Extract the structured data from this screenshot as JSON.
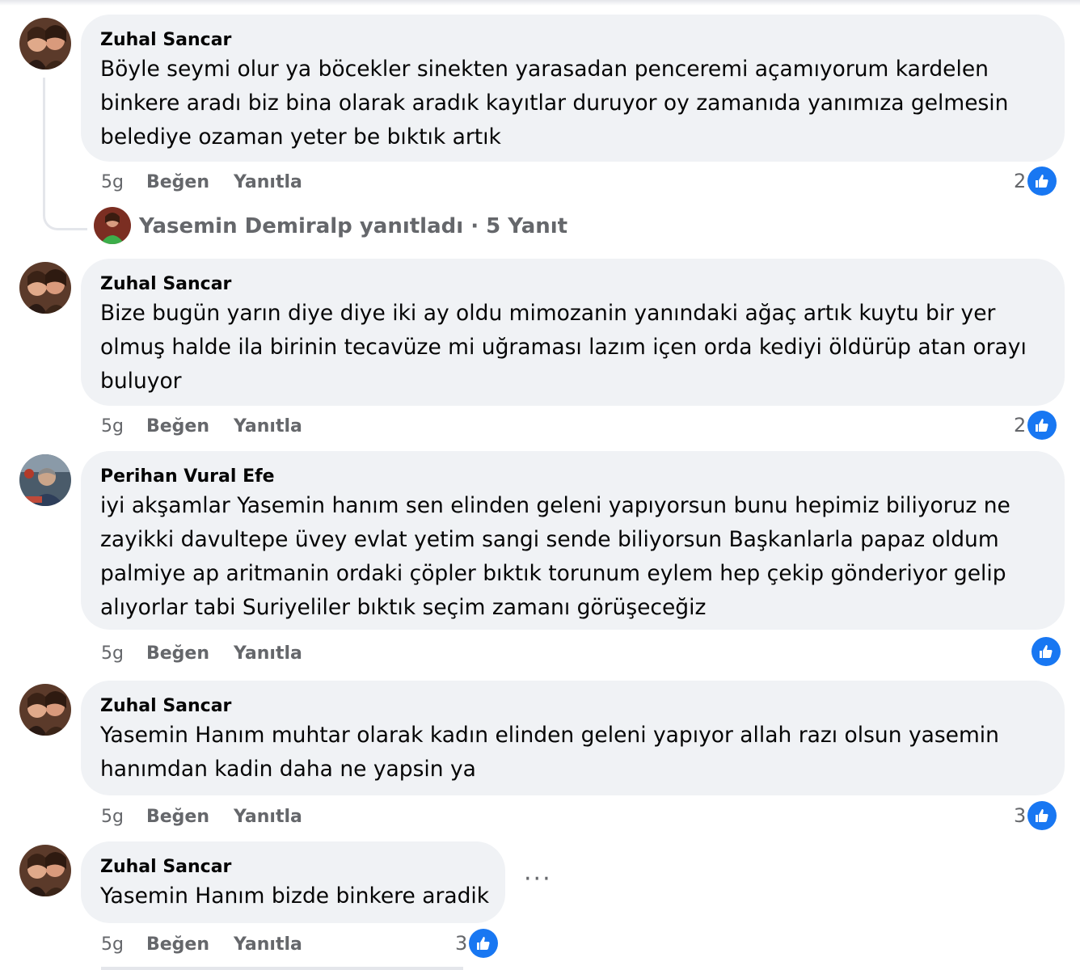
{
  "comments": [
    {
      "author": "Zuhal Sancar",
      "lines": [
        "Böyle seymi olur ya böcekler sinekten yarasadan penceremi açamıyorum kardelen",
        "binkere aradı biz bina olarak aradık kayıtlar duruyor oy zamanıda yanımıza gelmesin",
        "belediye ozaman yeter be bıktık artık"
      ],
      "time": "5g",
      "like": "Beğen",
      "reply": "Yanıtla",
      "reactions": "2",
      "replies_summary": "Yasemin Demiralp yanıtladı · 5 Yanıt"
    },
    {
      "author": "Zuhal Sancar",
      "lines": [
        "Bize bugün yarın diye diye iki ay oldu mimozanin yanındaki ağaç artık kuytu bir yer",
        "olmuş halde ila birinin tecavüze mi uğraması lazım içen orda kediyi öldürüp atan orayı",
        "buluyor"
      ],
      "time": "5g",
      "like": "Beğen",
      "reply": "Yanıtla",
      "reactions": "2"
    },
    {
      "author": "Perihan Vural Efe",
      "lines": [
        "iyi akşamlar Yasemin hanım sen elinden geleni yapıyorsun bunu hepimiz biliyoruz ne",
        "zayikki davultepe üvey evlat yetim sangi sende biliyorsun Başkanlarla papaz oldum",
        "palmiye ap aritmanin ordaki çöpler bıktık torunum eylem hep çekip gönderiyor gelip",
        "alıyorlar tabi Suriyeliler bıktık seçim zamanı görüşeceğiz"
      ],
      "time": "5g",
      "like": "Beğen",
      "reply": "Yanıtla",
      "reactions": ""
    },
    {
      "author": "Zuhal Sancar",
      "lines": [
        "Yasemin Hanım muhtar olarak kadın elinden geleni yapıyor allah razı olsun yasemin",
        "hanımdan kadin daha ne yapsin ya"
      ],
      "time": "5g",
      "like": "Beğen",
      "reply": "Yanıtla",
      "reactions": "3"
    },
    {
      "author": "Zuhal Sancar",
      "lines": [
        "Yasemin Hanım bizde binkere aradik"
      ],
      "time": "5g",
      "like": "Beğen",
      "reply": "Yanıtla",
      "reactions": "3",
      "more": "···"
    }
  ],
  "colors": {
    "like_blue": "#1877f2",
    "bubble": "#f0f2f5",
    "meta": "#65676b"
  },
  "icons": {
    "reaction": "thumbs-up-icon",
    "more": "more-options-icon"
  }
}
